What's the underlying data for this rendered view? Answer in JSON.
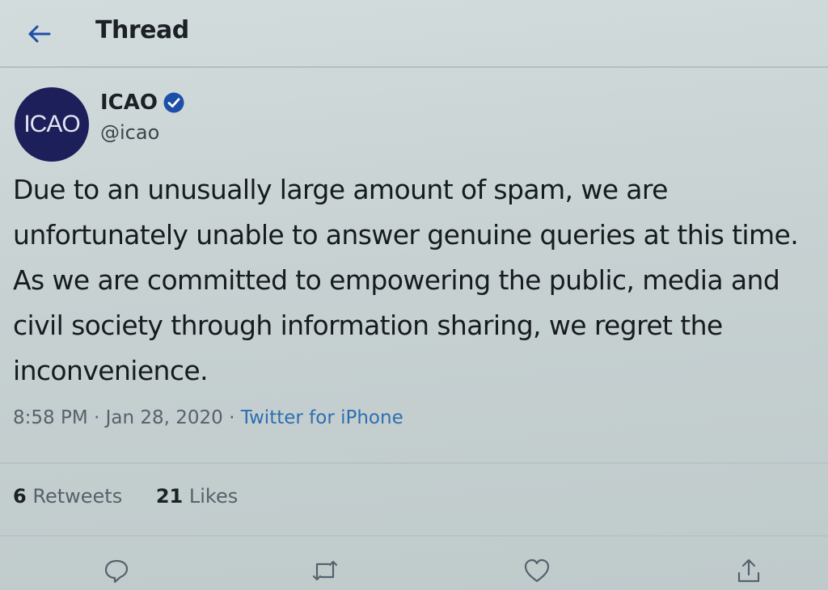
{
  "header": {
    "title": "Thread",
    "back_icon": "arrow-left-icon"
  },
  "author": {
    "avatar_text": "ICAO",
    "display_name": "ICAO",
    "handle": "@icao",
    "verified": true,
    "verified_icon": "verified-badge-icon"
  },
  "tweet": {
    "text": "Due to an unusually large amount of spam, we are unfortunately unable to answer genuine queries at this time. As we are committed to empowering the public, media and civil society through information sharing, we regret the inconvenience.",
    "time": "8:58 PM",
    "date": "Jan 28, 2020",
    "source": "Twitter for iPhone"
  },
  "stats": {
    "retweets_count": "6",
    "retweets_label": "Retweets",
    "likes_count": "21",
    "likes_label": "Likes"
  },
  "actions": [
    "reply-icon",
    "retweet-icon",
    "like-icon",
    "share-icon"
  ],
  "colors": {
    "accent": "#1d4fa8",
    "link": "#2c6fb0",
    "avatar_bg": "#1d1f5a"
  }
}
